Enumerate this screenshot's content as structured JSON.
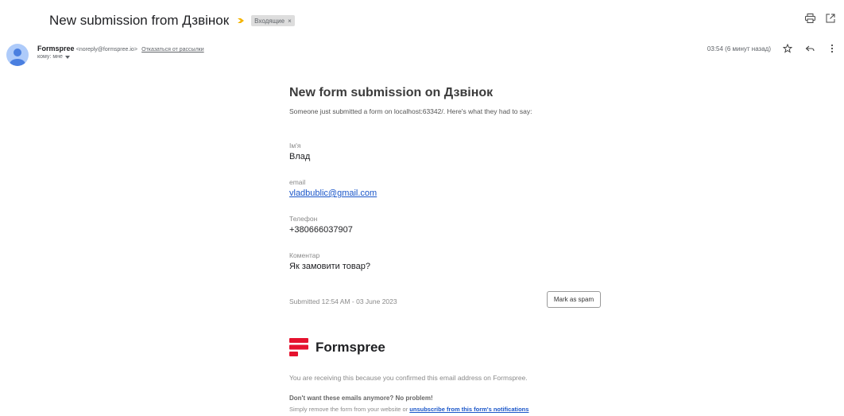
{
  "subject": "New submission from Дзвінок",
  "label_chip": "Входящие",
  "label_chip_close": "×",
  "sender": {
    "name": "Formspree",
    "email": "<noreply@formspree.io>",
    "unsubscribe": "Отказаться от рассылки",
    "to_line": "кому: мне"
  },
  "meta": {
    "date": "03:54 (6 минут назад)"
  },
  "icons": {
    "print": "printer-icon",
    "open_new": "open-in-new-window-icon",
    "star": "star-icon",
    "reply": "reply-icon",
    "more": "more-vert-icon",
    "importance": "importance-marker-icon"
  },
  "body": {
    "title": "New form submission on Дзвінок",
    "intro": "Someone just submitted a form on localhost:63342/. Here's what they had to say:",
    "fields": [
      {
        "label": "Ім'я",
        "value": "Влад"
      },
      {
        "label": "email",
        "value": "vladbublic@gmail.com"
      },
      {
        "label": "Телефон",
        "value": "+380666037907"
      },
      {
        "label": "Коментар",
        "value": "Як замовити товар?"
      }
    ],
    "submitted": "Submitted 12:54 AM - 03 June 2023",
    "spam_button": "Mark as spam",
    "brand": "Formspree",
    "receiving_note": "You are receiving this because you confirmed this email address on Formspree.",
    "dont_want": "Don't want these emails anymore? No problem!",
    "simply_prefix": "Simply remove the form from your website or ",
    "simply_link": "unsubscribe from this form's notifications"
  },
  "colors": {
    "brand_red": "#e5122e",
    "link_blue": "#1a56c9",
    "importance_yellow": "#f4b400"
  }
}
